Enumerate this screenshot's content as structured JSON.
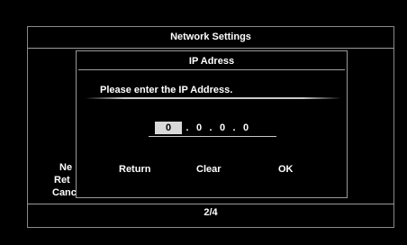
{
  "background_screen": {
    "title": "Network Settings",
    "page_indicator": "2/4",
    "menu_items": [
      "Ne",
      "Ret",
      "Cancel"
    ]
  },
  "dialog": {
    "title": "IP Adress",
    "prompt": "Please enter the IP Address.",
    "ip_octets": [
      "0",
      "0",
      "0",
      "0"
    ],
    "separator": ".",
    "active_octet_index": 0,
    "buttons": {
      "return_label": "Return",
      "clear_label": "Clear",
      "ok_label": "OK"
    }
  }
}
